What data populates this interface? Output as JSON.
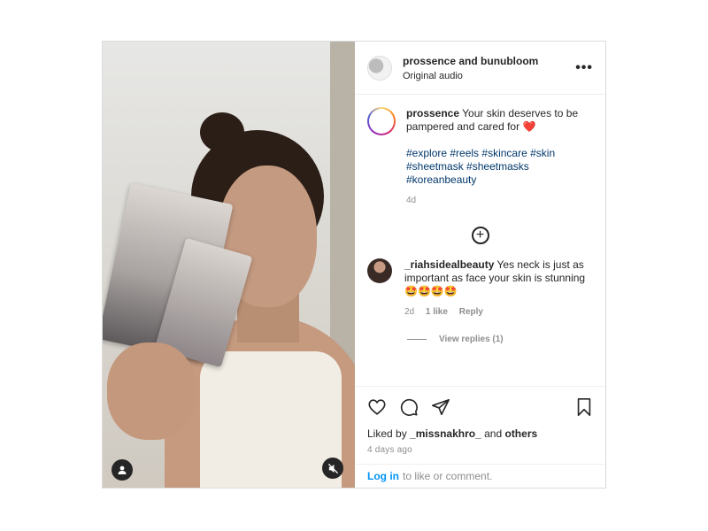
{
  "post": {
    "header": {
      "accounts": "prossence and bunubloom",
      "audio": "Original audio",
      "more_icon": "more-horizontal-icon"
    },
    "caption": {
      "username": "prossence",
      "text": "Your skin deserves to be pampered and cared for",
      "emoji": "❤️",
      "hashtags": [
        "#explore",
        "#reels",
        "#skincare",
        "#skin",
        "#sheetmask",
        "#sheetmasks",
        "#koreanbeauty"
      ],
      "time": "4d"
    },
    "add_comment_icon": "plus-circle-icon",
    "comment": {
      "username": "_riahsidealbeauty",
      "text": "Yes neck is just as important as face your skin is stunning",
      "emojis": "🤩🤩🤩🤩",
      "time": "2d",
      "likes": "1 like",
      "reply_label": "Reply",
      "view_replies": "View replies (1)"
    },
    "actions": {
      "liked_prefix": "Liked by",
      "liked_user": "_missnakhro_",
      "liked_and": "and",
      "liked_others": "others",
      "time_ago": "4 days ago"
    },
    "login": {
      "link": "Log in",
      "text": "to like or comment."
    },
    "colors": {
      "link_blue": "#0095f6",
      "hashtag_blue": "#00376b",
      "muted_gray": "#8e8e8e",
      "text": "#262626"
    }
  }
}
